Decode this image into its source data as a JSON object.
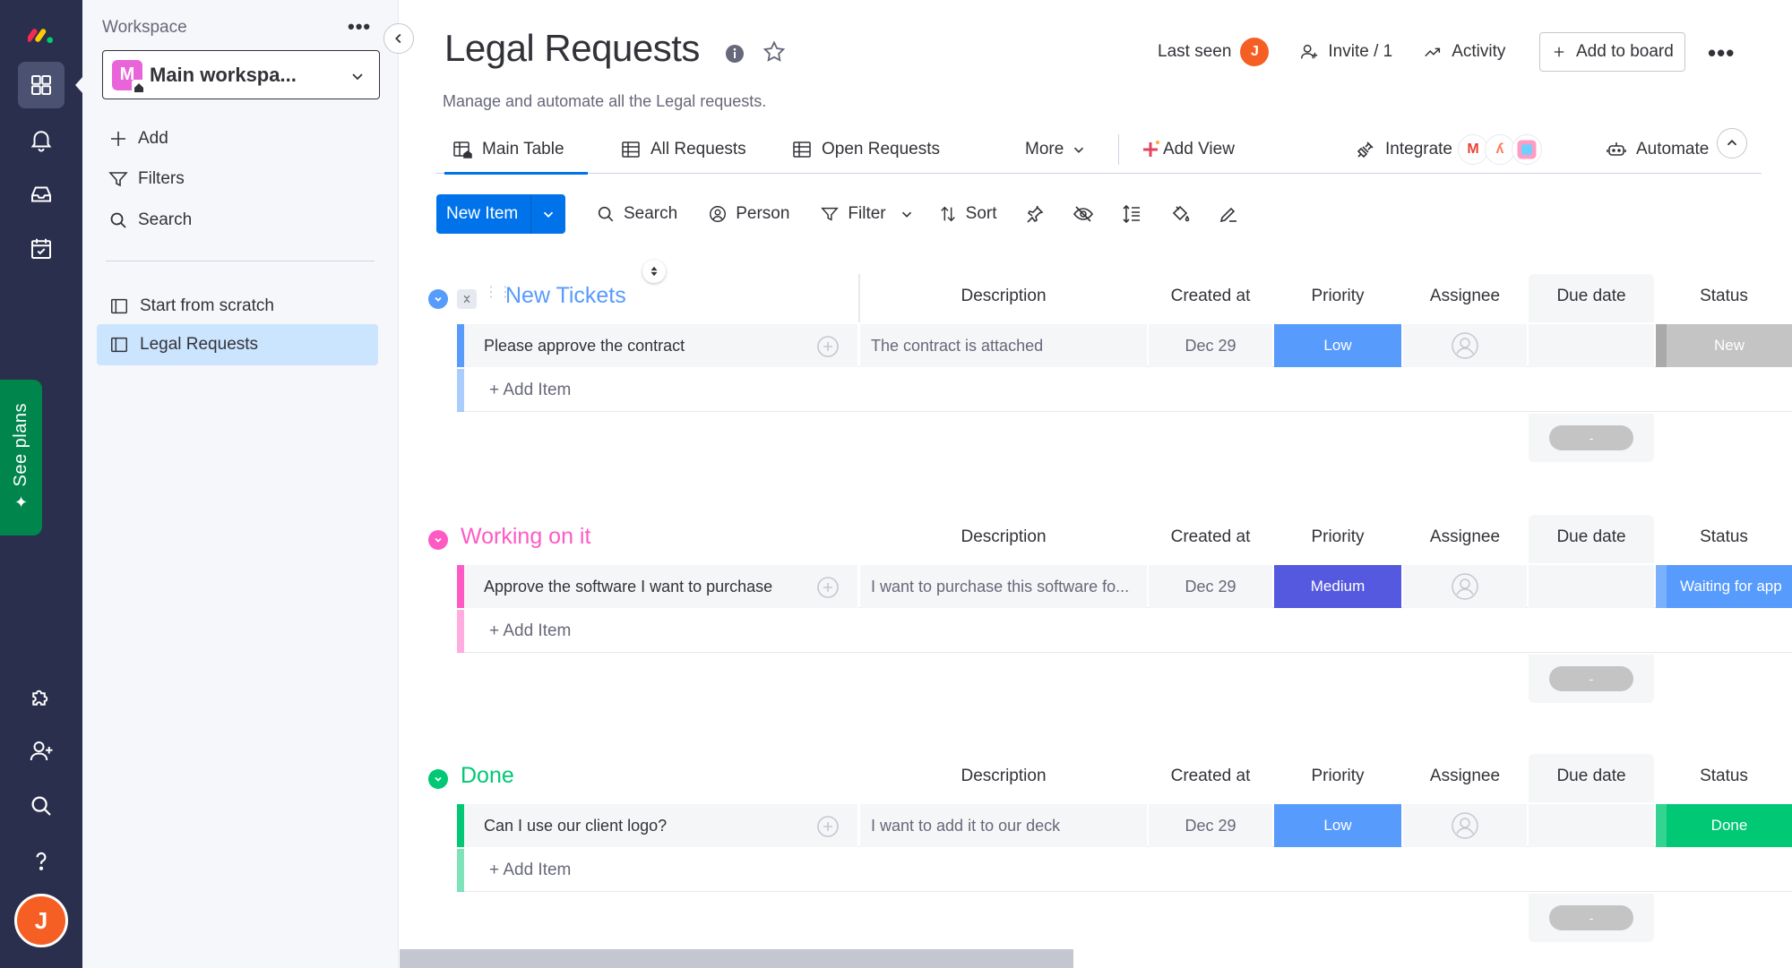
{
  "rail": {
    "see_plans": "See plans",
    "avatar_initial": "J"
  },
  "workspace": {
    "label": "Workspace",
    "selected_initial": "M",
    "selected_name": "Main workspa...",
    "actions": {
      "add": "Add",
      "filters": "Filters",
      "search": "Search"
    },
    "boards": [
      {
        "label": "Start from scratch"
      },
      {
        "label": "Legal Requests"
      }
    ]
  },
  "header": {
    "title": "Legal Requests",
    "description": "Manage and automate all the Legal requests.",
    "last_seen": "Last seen",
    "last_seen_initial": "J",
    "invite": "Invite / 1",
    "activity": "Activity",
    "add_to_board": "Add to board"
  },
  "tabs": {
    "main_table": "Main Table",
    "all_requests": "All Requests",
    "open_requests": "Open Requests",
    "more": "More",
    "add_view": "Add View",
    "integrate": "Integrate",
    "automate": "Automate"
  },
  "toolbar": {
    "new_item": "New Item",
    "search": "Search",
    "person": "Person",
    "filter": "Filter",
    "sort": "Sort"
  },
  "columns": {
    "description": "Description",
    "created_at": "Created at",
    "priority": "Priority",
    "assignee": "Assignee",
    "due_date": "Due date",
    "status": "Status"
  },
  "groups": [
    {
      "title": "New Tickets",
      "color": "#579bfc",
      "add_item": "+ Add Item",
      "summary": "-",
      "items": [
        {
          "name": "Please approve the contract",
          "description": "The contract is attached",
          "created_at": "Dec 29",
          "priority": "Low",
          "priority_color": "#579bfc",
          "status": "New",
          "status_color": "#c4c4c4"
        }
      ]
    },
    {
      "title": "Working on it",
      "color": "#ff5ac4",
      "add_item": "+ Add Item",
      "summary": "-",
      "items": [
        {
          "name": "Approve the software I want to purchase",
          "description": "I want to purchase this software fo...",
          "created_at": "Dec 29",
          "priority": "Medium",
          "priority_color": "#5559df",
          "status": "Waiting for app",
          "status_color": "#579bfc"
        }
      ]
    },
    {
      "title": "Done",
      "color": "#00c875",
      "add_item": "+ Add Item",
      "summary": "-",
      "items": [
        {
          "name": "Can I use our client logo?",
          "description": "I want to add it to our deck",
          "created_at": "Dec 29",
          "priority": "Low",
          "priority_color": "#579bfc",
          "status": "Done",
          "status_color": "#00c875"
        }
      ]
    }
  ],
  "colors": {
    "rail_bg": "#292f4c",
    "primary": "#0073ea",
    "see_plans": "#00854d",
    "avatar": "#f65f24"
  }
}
